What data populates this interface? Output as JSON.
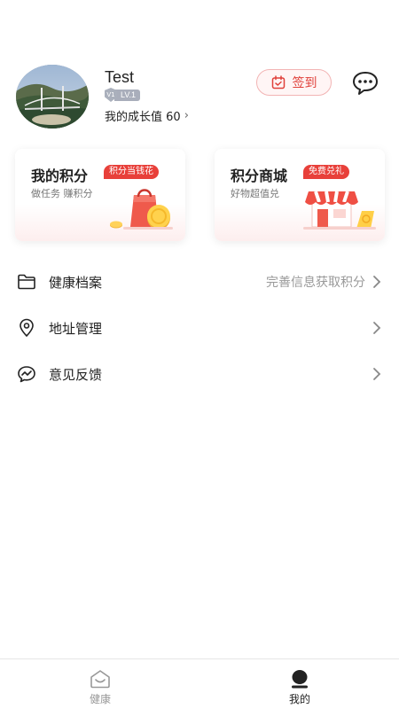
{
  "profile": {
    "username": "Test",
    "level_icon_text": "V1",
    "level_text": "LV.1",
    "growth_label": "我的成长值 60",
    "checkin_label": "签到"
  },
  "cards": [
    {
      "title": "我的积分",
      "tag": "积分当钱花",
      "subtitle": "做任务 赚积分"
    },
    {
      "title": "积分商城",
      "tag": "免费兑礼",
      "subtitle": "好物超值兑"
    }
  ],
  "menu": [
    {
      "label": "健康档案",
      "hint": "完善信息获取积分",
      "icon": "folder-icon"
    },
    {
      "label": "地址管理",
      "hint": "",
      "icon": "location-pin-icon"
    },
    {
      "label": "意见反馈",
      "hint": "",
      "icon": "feedback-chat-icon"
    }
  ],
  "tabs": [
    {
      "label": "健康",
      "icon": "health-home-icon",
      "active": false
    },
    {
      "label": "我的",
      "icon": "user-icon",
      "active": true
    }
  ],
  "colors": {
    "accent": "#e8403a",
    "text_primary": "#222222",
    "text_secondary": "#999999"
  }
}
